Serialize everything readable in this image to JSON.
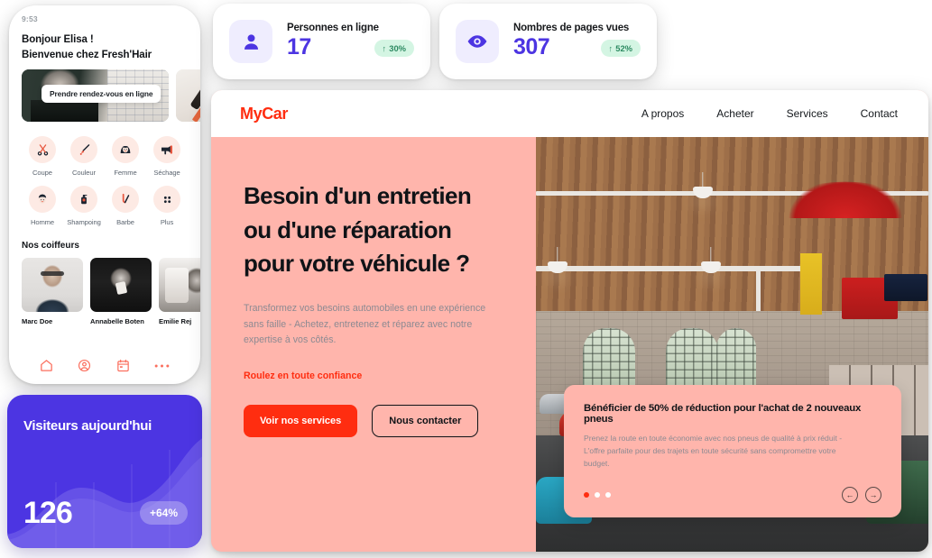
{
  "phone": {
    "status_time": "9:53",
    "greeting_line1": "Bonjour Elisa !",
    "greeting_line2": "Bienvenue chez Fresh'Hair",
    "banner_cta": "Prendre rendez-vous en ligne",
    "services": [
      {
        "label": "Coupe",
        "icon": "scissors-icon"
      },
      {
        "label": "Couleur",
        "icon": "hair-brush-icon"
      },
      {
        "label": "Femme",
        "icon": "woman-icon"
      },
      {
        "label": "Séchage",
        "icon": "hair-dryer-icon"
      },
      {
        "label": "Homme",
        "icon": "man-icon"
      },
      {
        "label": "Shampoing",
        "icon": "shampoo-bottle-icon"
      },
      {
        "label": "Barbe",
        "icon": "razor-icon"
      },
      {
        "label": "Plus",
        "icon": "grid-dots-icon"
      }
    ],
    "stylists_title": "Nos coiffeurs",
    "stylists": [
      {
        "name": "Marc Doe"
      },
      {
        "name": "Annabelle Boten"
      },
      {
        "name": "Emilie Rej"
      }
    ],
    "tabbar": [
      {
        "icon": "home-icon"
      },
      {
        "icon": "account-icon"
      },
      {
        "icon": "calendar-icon"
      },
      {
        "icon": "more-dots-icon"
      }
    ]
  },
  "stats": [
    {
      "title": "Personnes en ligne",
      "value": "17",
      "delta": "30%",
      "delta_arrow": "↑",
      "icon": "person-icon"
    },
    {
      "title": "Nombres de pages vues",
      "value": "307",
      "delta": "52%",
      "delta_arrow": "↑",
      "icon": "eye-icon"
    }
  ],
  "visitors": {
    "title": "Visiteurs aujourd'hui",
    "value": "126",
    "delta": "+64%"
  },
  "site": {
    "brand": "MyCar",
    "nav": [
      {
        "label": "A propos"
      },
      {
        "label": "Acheter"
      },
      {
        "label": "Services"
      },
      {
        "label": "Contact"
      }
    ],
    "hero": {
      "heading_line1": "Besoin d'un entretien",
      "heading_line2": "ou d'une réparation",
      "heading_line3": "pour votre véhicule ?",
      "paragraph": "Transformez vos besoins automobiles en une expérience sans faille - Achetez, entretenez et réparez avec notre expertise à vos côtés.",
      "tagline": "Roulez en toute confiance",
      "primary_button": "Voir nos services",
      "secondary_button": "Nous contacter"
    },
    "promo": {
      "title": "Bénéficier de 50% de réduction pour l'achat de 2 nouveaux pneus",
      "text": "Prenez la route en toute économie avec nos pneus de qualité à prix réduit - L'offre parfaite pour des trajets en toute sécurité sans compromettre votre budget.",
      "dots_total": 3,
      "dots_active_index": 0,
      "prev_arrow": "←",
      "next_arrow": "→"
    }
  },
  "colors": {
    "accent_red": "#FF2D10",
    "accent_purple": "#4C35E2",
    "pink_bg": "#FFB5AC",
    "badge_green_bg": "#D4F5E3",
    "badge_green_text": "#2C8A61",
    "phone_icon_bubble": "#FDEAE4",
    "phone_nav_icon": "#FB6F5E"
  }
}
